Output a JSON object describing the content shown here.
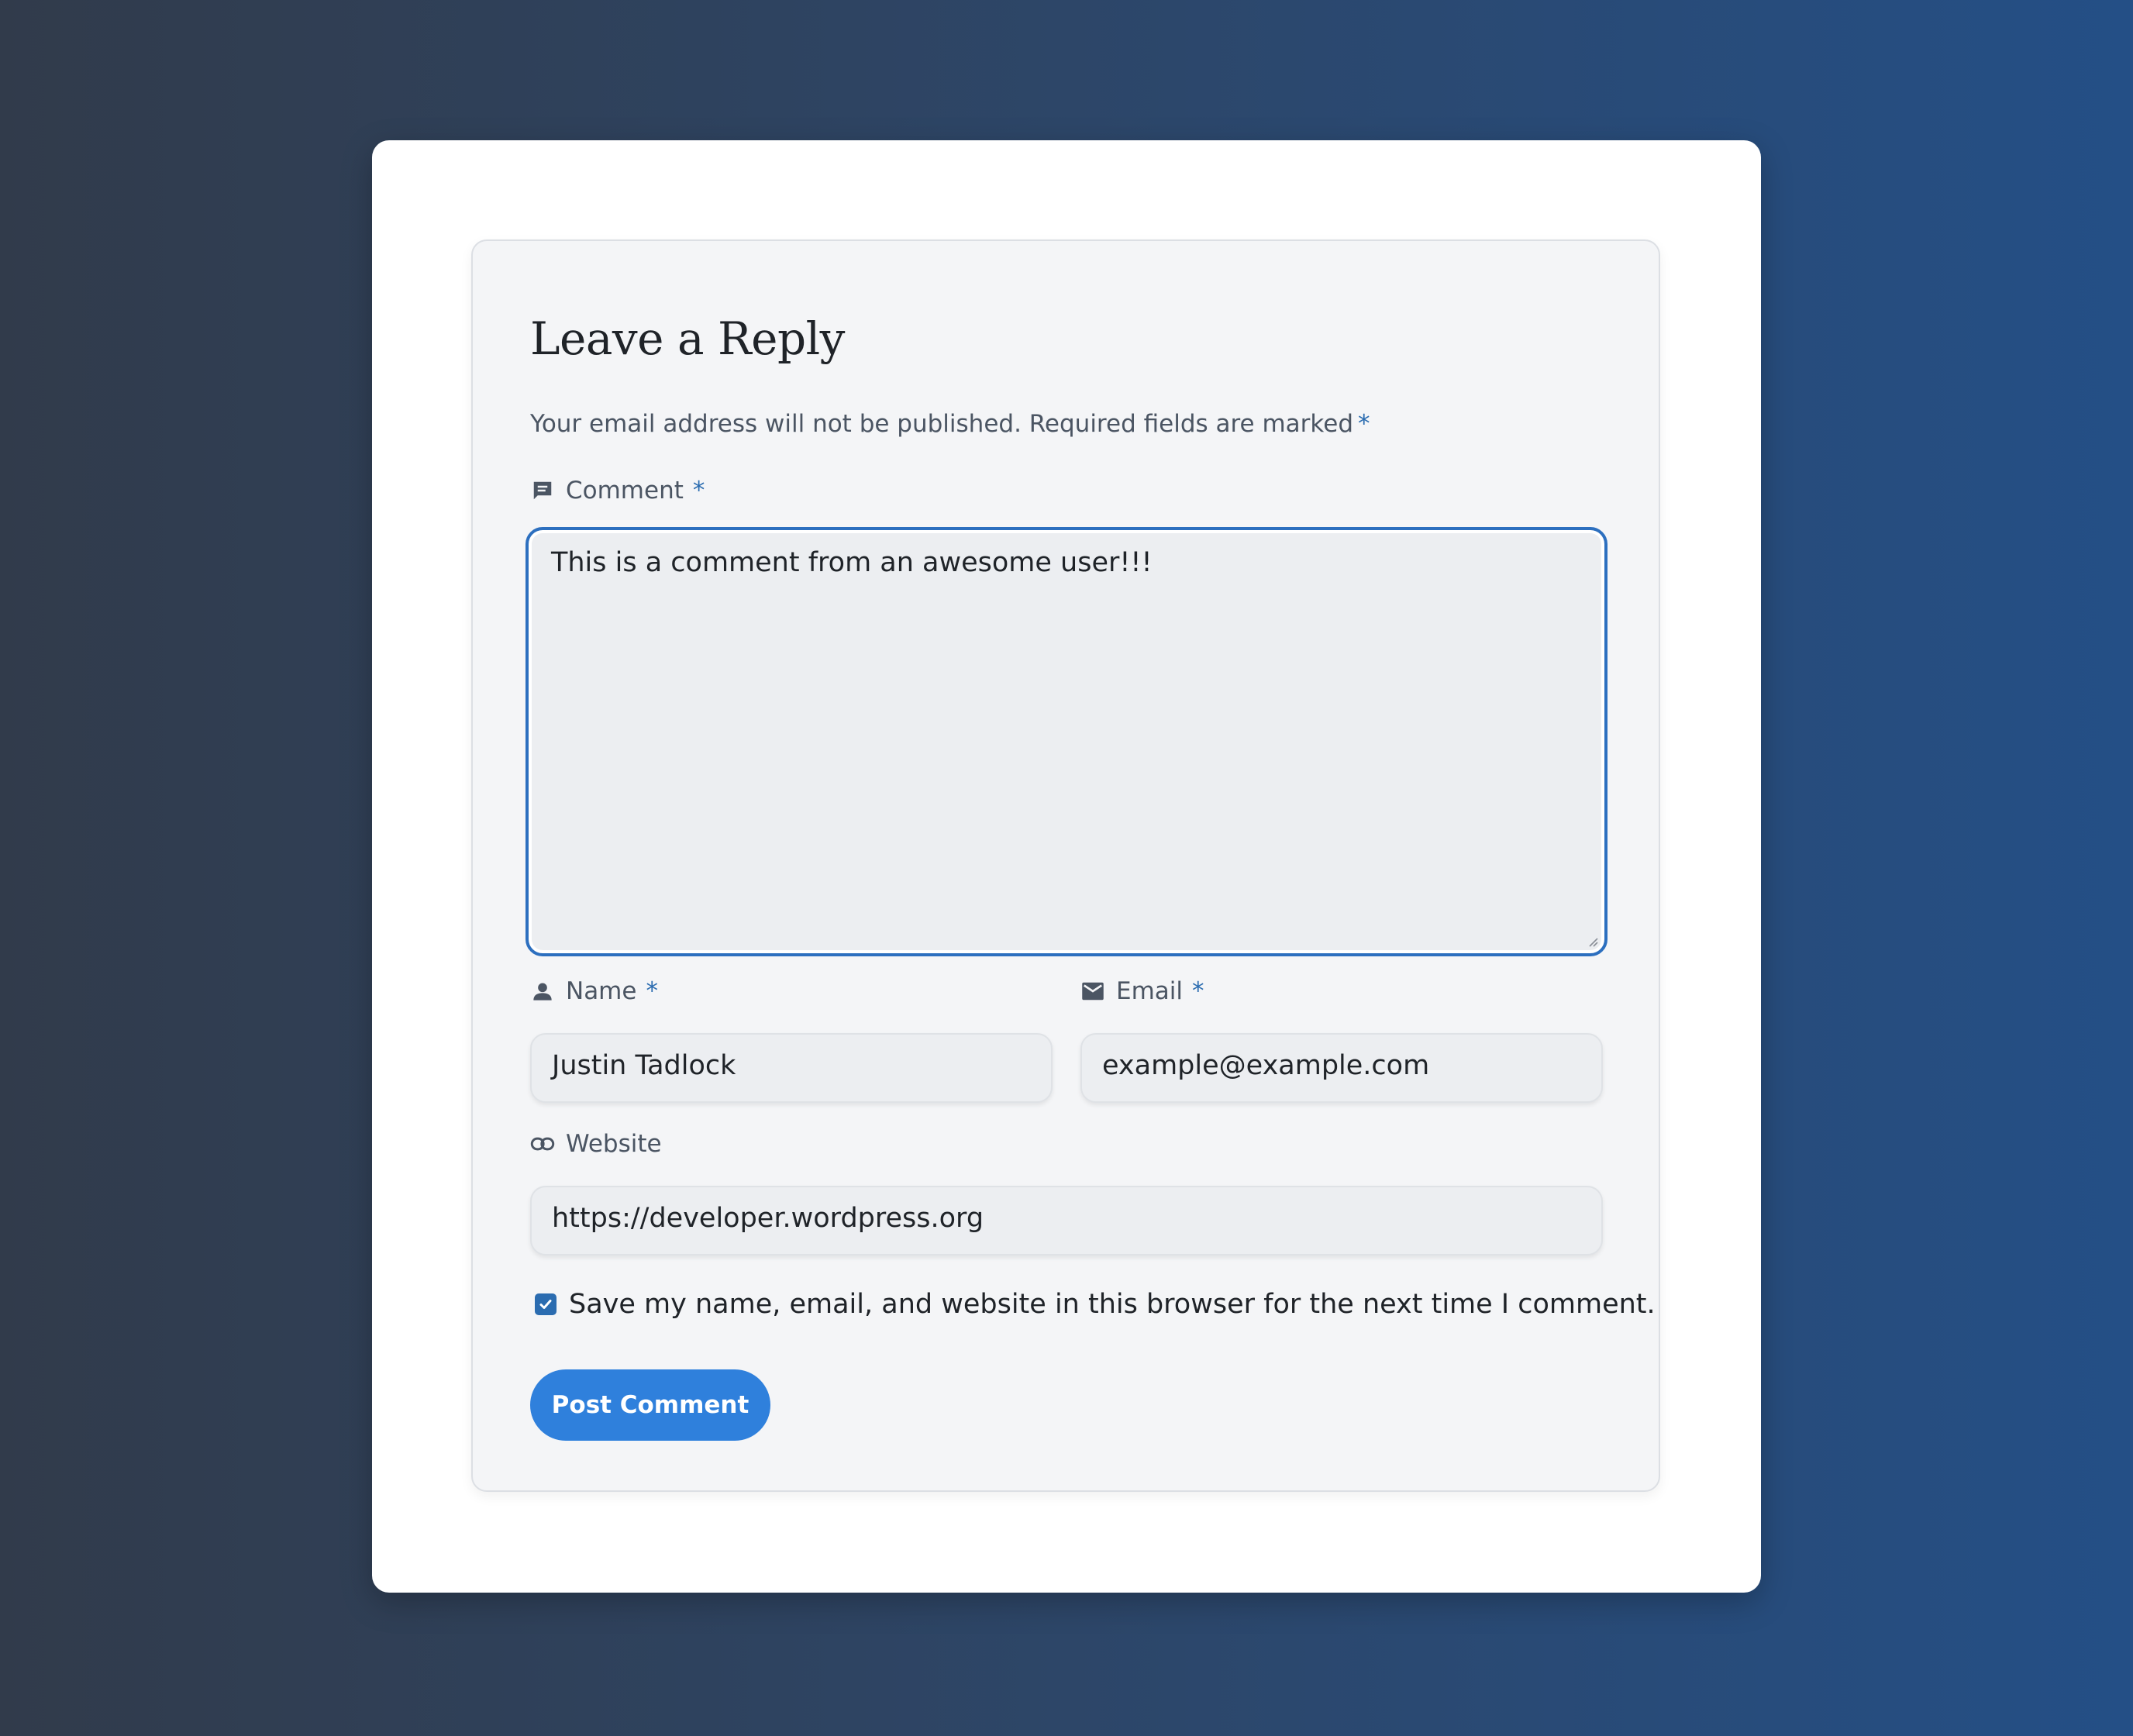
{
  "form": {
    "title": "Leave a Reply",
    "notes": "Your email address will not be published. Required fields are marked",
    "required_marker": "*",
    "comment": {
      "label": "Comment",
      "value": "This is a comment from an awesome user!!!",
      "icon": "comment-icon"
    },
    "name": {
      "label": "Name",
      "value": "Justin Tadlock",
      "icon": "person-icon"
    },
    "email": {
      "label": "Email",
      "value": "example@example.com",
      "icon": "mail-icon"
    },
    "website": {
      "label": "Website",
      "value": "https://developer.wordpress.org",
      "icon": "link-icon"
    },
    "cookies": {
      "label": "Save my name, email, and website in this browser for the next time I comment.",
      "checked": true
    },
    "submit_label": "Post Comment"
  },
  "colors": {
    "accent": "#2b6cb0",
    "button": "#2f80dc",
    "focus_border": "#2c6fbf"
  }
}
